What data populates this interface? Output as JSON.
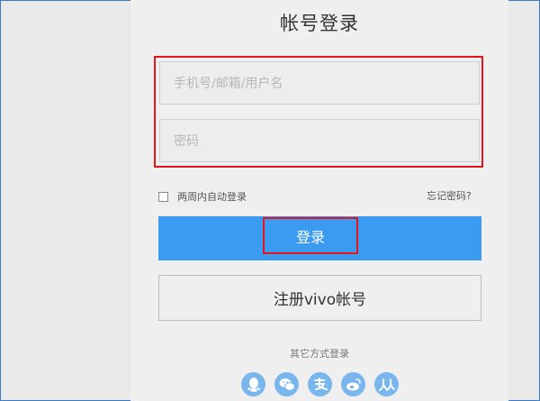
{
  "page": {
    "title": "帐号登录"
  },
  "form": {
    "account_placeholder": "手机号/邮箱/用户名",
    "password_placeholder": "密码",
    "remember_label": "两周内自动登录",
    "forgot_label": "忘记密码?",
    "login_label": "登录",
    "register_label": "注册vivo帐号"
  },
  "social": {
    "heading": "其它方式登录",
    "icons": [
      "qq-icon",
      "wechat-icon",
      "alipay-icon",
      "weibo-icon",
      "renren-icon"
    ]
  },
  "colors": {
    "primary": "#3a9bf0",
    "highlight": "#e8141b",
    "social": "#79b6ee"
  }
}
